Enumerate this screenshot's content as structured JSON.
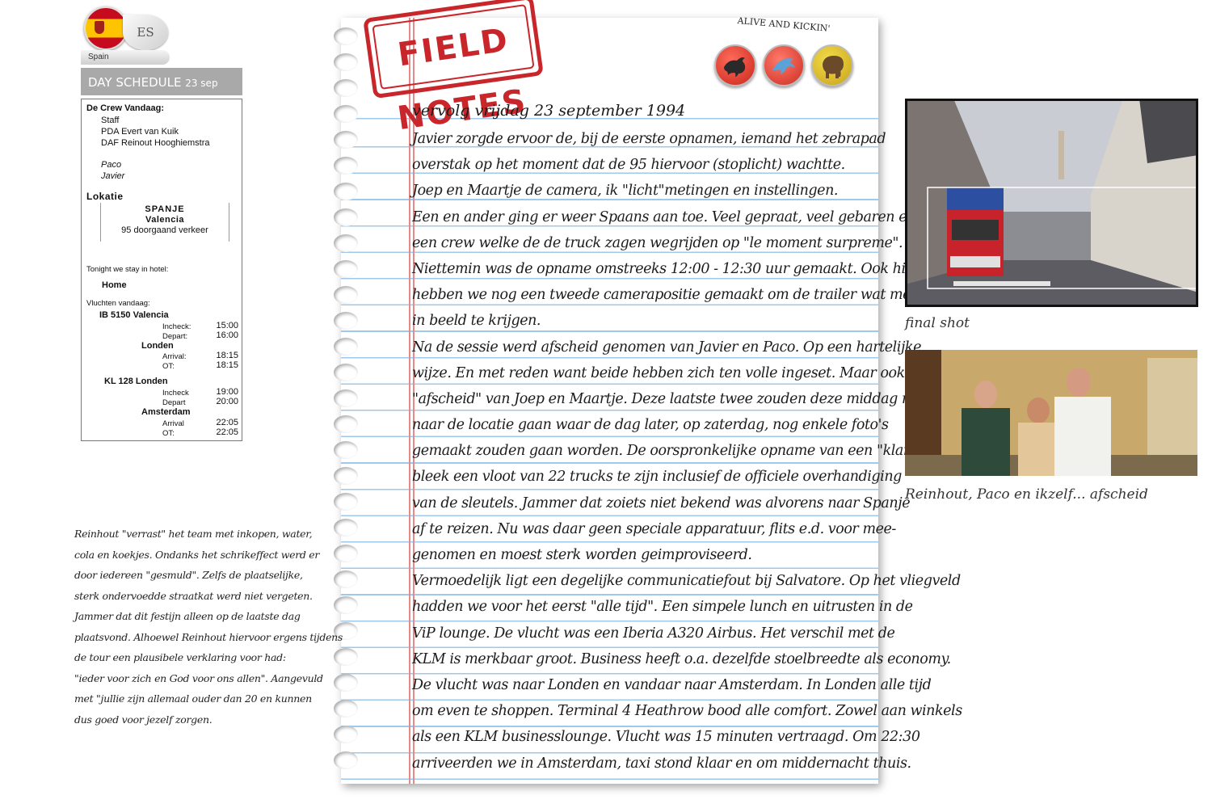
{
  "country": {
    "code": "ES",
    "name": "Spain"
  },
  "schedule": {
    "title": "DAY SCHEDULE",
    "date": "23 sep",
    "crew_heading": "De Crew Vandaag:",
    "crew": [
      "Staff",
      "PDA Evert van Kuik",
      "DAF Reinout Hooghiemstra"
    ],
    "locals": [
      "Paco",
      "Javier"
    ],
    "location_heading": "Lokatie",
    "location": [
      "SPANJE",
      "Valencia",
      "95 doorgaand verkeer"
    ],
    "hotel_heading": "Tonight we stay in hotel:",
    "hotel": "Home",
    "flights_heading": "Vluchten vandaag:",
    "flights": [
      {
        "flight": "IB 5150 Valencia",
        "rows": [
          {
            "label": "Incheck:",
            "time": "15:00"
          },
          {
            "label": "Depart:",
            "time": "16:00"
          }
        ],
        "dest": "Londen",
        "dest_rows": [
          {
            "label": "Arrival:",
            "time": "18:15"
          },
          {
            "label": "OT:",
            "time": "18:15"
          }
        ]
      },
      {
        "flight": "KL 128 Londen",
        "rows": [
          {
            "label": "Incheck",
            "time": "19:00"
          },
          {
            "label": "Depart",
            "time": "20:00"
          }
        ],
        "dest": "Amsterdam",
        "dest_rows": [
          {
            "label": "Arrival",
            "time": "22:05"
          },
          {
            "label": "OT:",
            "time": "22:05"
          }
        ]
      }
    ]
  },
  "stamp": "FIELD NOTES",
  "slogan": "ALIVE AND KICKIN'",
  "medals": [
    "bull-medal",
    "dolphin-medal",
    "elephant-medal"
  ],
  "note": {
    "title": "vervolg vrijdag 23 september 1994",
    "lines": [
      "Javier zorgde ervoor de, bij de eerste opnamen, iemand het zebrapad",
      "overstak op het moment dat de 95 hiervoor (stoplicht) wachtte.",
      "Joep en Maartje de camera, ik \"licht\"metingen en instellingen.",
      "Een en ander ging er weer Spaans aan toe. Veel gepraat, veel gebaren en",
      "een crew welke de de truck zagen wegrijden op \"le moment surpreme\".",
      "Niettemin was de opname omstreeks 12:00 - 12:30 uur gemaakt. Ook hier",
      "hebben we nog een tweede camerapositie gemaakt om de trailer wat meer",
      "in beeld te krijgen.",
      "Na de sessie werd afscheid genomen van Javier en Paco. Op een hartelijke",
      "wijze. En met reden want beide hebben zich ten volle ingeset. Maar ook",
      "\"afscheid\" van Joep en Maartje. Deze laatste twee zouden deze middag nog",
      "naar de locatie gaan waar de dag later, op zaterdag, nog enkele foto's",
      "gemaakt zouden gaan worden. De oorspronkelijke opname van een \"klantenvoertuig\"",
      "bleek een vloot van 22 trucks te zijn inclusief de officiele overhandiging",
      "van de sleutels. Jammer dat zoiets niet bekend was alvorens naar Spanje",
      "af te reizen. Nu was daar geen speciale apparatuur, flits e.d. voor mee-",
      "genomen en moest sterk worden geimproviseerd.",
      "Vermoedelijk ligt een degelijke communicatiefout bij Salvatore. Op het vliegveld",
      "hadden we voor het eerst \"alle tijd\". Een simpele lunch en uitrusten in de",
      "ViP lounge. De vlucht was een Iberia A320 Airbus. Het verschil met de",
      "KLM is merkbaar groot. Business heeft o.a. dezelfde stoelbreedte als economy.",
      "De vlucht was naar Londen en vandaar naar Amsterdam. In Londen alle tijd",
      "om even te shoppen. Terminal 4 Heathrow bood alle comfort. Zowel aan winkels",
      "als een KLM businesslounge. Vlucht was 15 minuten vertraagd.  Om 22:30",
      "arriveerden we in Amsterdam, taxi stond klaar en om middernacht thuis."
    ]
  },
  "photos": {
    "caption1": "final shot",
    "caption2": "Reinhout, Paco en ikzelf... afscheid"
  },
  "sidenote": [
    "Reinhout \"verrast\" het team met inkopen, water,",
    "cola en koekjes. Ondanks het schrikeffect werd er",
    "door iedereen \"gesmuld\". Zelfs de plaatselijke,",
    "sterk ondervoedde straatkat werd niet vergeten.",
    "Jammer dat dit festijn alleen op de laatste dag",
    "plaatsvond. Alhoewel Reinhout hiervoor ergens tijdens",
    "de tour een plausibele verklaring voor had:",
    "\"ieder voor zich en God voor ons allen\". Aangevuld",
    "met \"jullie zijn allemaal ouder dan 20 en kunnen",
    "dus goed voor jezelf zorgen."
  ]
}
